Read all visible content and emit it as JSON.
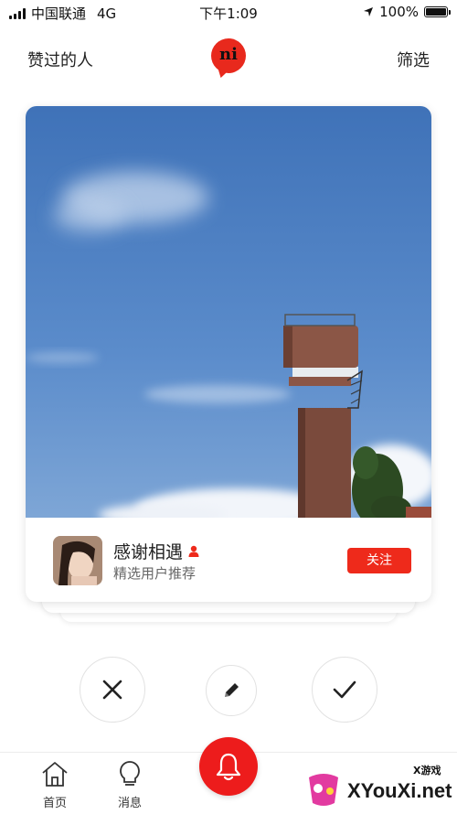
{
  "status_bar": {
    "carrier": "中国联通",
    "network": "4G",
    "time": "下午1:09",
    "battery": "100%",
    "battery_level": 1.0
  },
  "header": {
    "left_label": "赞过的人",
    "logo_text": "ni",
    "right_label": "筛选"
  },
  "card": {
    "user_name": "感谢相遇",
    "user_subtitle": "精选用户推荐",
    "follow_label": "关注"
  },
  "actions": {
    "dislike_icon": "close-icon",
    "comment_icon": "pencil-icon",
    "like_icon": "check-icon"
  },
  "bottom_nav": {
    "items": [
      {
        "label": "首页",
        "icon": "home-icon"
      },
      {
        "label": "消息",
        "icon": "lightbulb-icon"
      }
    ],
    "center_icon": "bell-icon"
  },
  "watermark": {
    "text": "XYouXi.net",
    "top_text": "X游戏"
  },
  "colors": {
    "accent": "#ee2a1b",
    "sky": "#4a7cc0"
  }
}
